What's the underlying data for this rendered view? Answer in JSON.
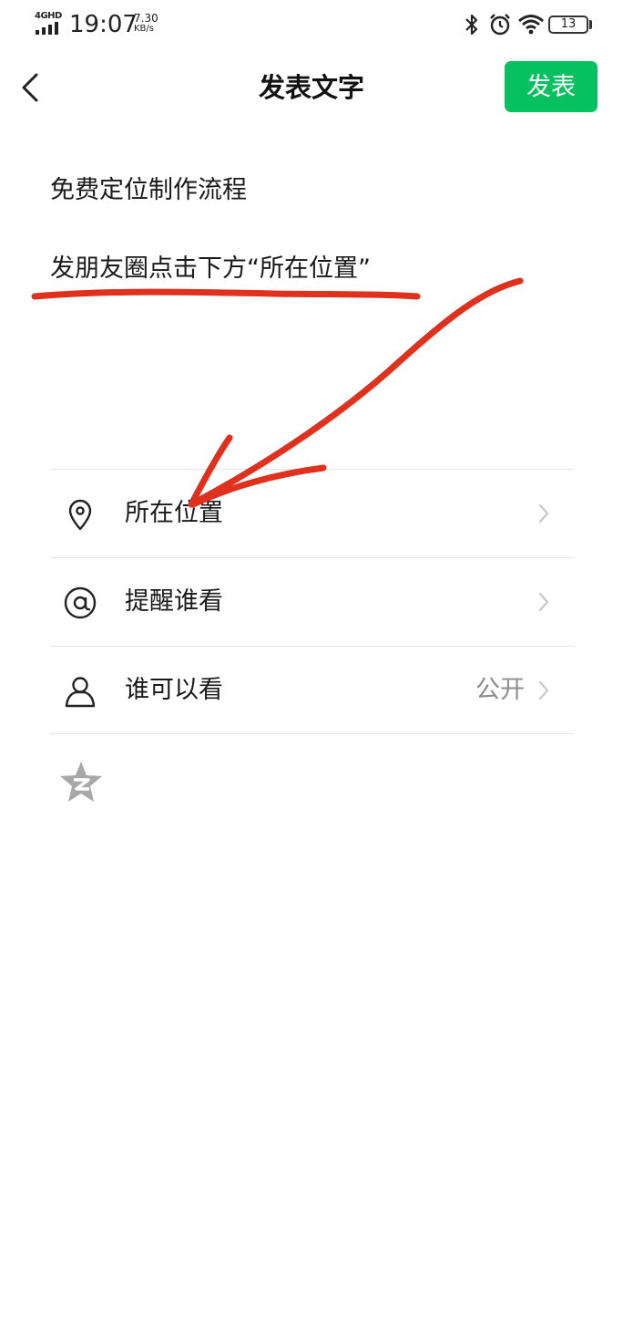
{
  "status_bar": {
    "network": "4GHD",
    "time": "19:07",
    "speed_value": "7.30",
    "speed_unit": "KB/s",
    "battery": "13",
    "icons": [
      "signal-icon",
      "bluetooth-icon",
      "alarm-icon",
      "wifi-icon",
      "battery-icon"
    ]
  },
  "header": {
    "title": "发表文字",
    "publish_label": "发表",
    "back_icon": "chevron-left-icon"
  },
  "post": {
    "lines": [
      "免费定位制作流程",
      "发朋友圈点击下方“所在位置”"
    ]
  },
  "options": [
    {
      "label": "所在位置",
      "icon": "location-pin-icon",
      "value": ""
    },
    {
      "label": "提醒谁看",
      "icon": "at-sign-icon",
      "value": ""
    },
    {
      "label": "谁可以看",
      "icon": "user-icon",
      "value": "公开"
    }
  ],
  "qzone": {
    "icon": "qzone-star-icon"
  },
  "colors": {
    "accent": "#07c160",
    "annotation": "#e0301e",
    "divider": "#e6e6e6",
    "secondary_text": "#8c8c8c"
  }
}
